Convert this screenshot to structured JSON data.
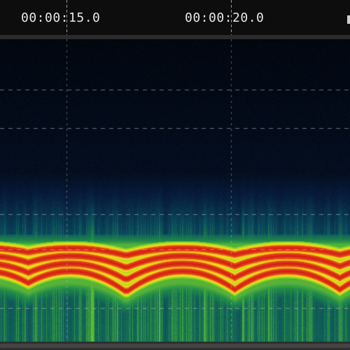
{
  "timeline": {
    "labels": [
      "00:00:15.0",
      "00:00:20.0"
    ]
  },
  "spectrogram": {
    "colormap": [
      "#000000",
      "#071a3a",
      "#0a4a5e",
      "#1f8a4a",
      "#7fd22a",
      "#f2e317",
      "#e8461a",
      "#c81414"
    ],
    "grid_line_color": "#bfbfbf"
  }
}
